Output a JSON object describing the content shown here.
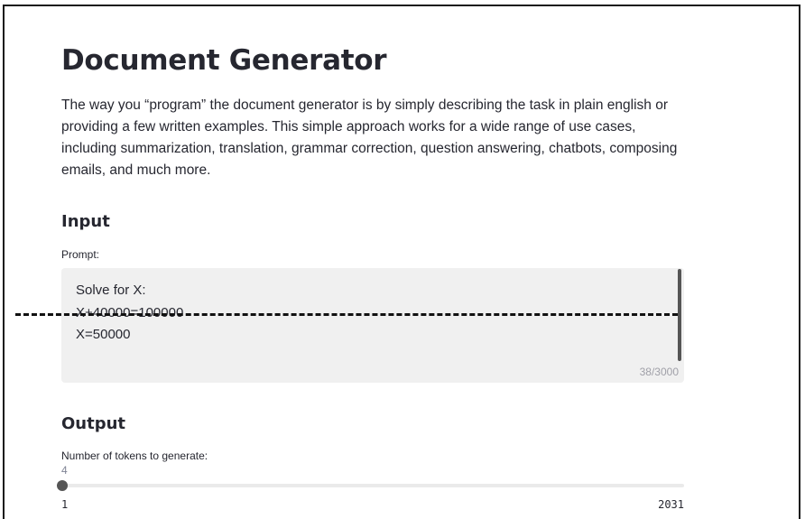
{
  "page": {
    "title": "Document Generator",
    "description": "The way you “program” the document generator is by simply describing the task in plain english or providing a few written examples. This simple approach works for a wide range of use cases, including summarization, translation, grammar correction, question answering, chatbots, composing emails, and much more."
  },
  "input": {
    "heading": "Input",
    "prompt_label": "Prompt:",
    "prompt_value": "Solve for X:\nX+40000=100000\nX=50000",
    "char_count": "38/3000"
  },
  "output": {
    "heading": "Output",
    "tokens_label": "Number of tokens to generate:",
    "tokens_value": "4",
    "tokens_min": "1",
    "tokens_max": "2031"
  },
  "colors": {
    "text": "#262730",
    "slider": "#555555",
    "annotation_line": "#111111"
  },
  "icons": {
    "slider_thumb": "slider-thumb-icon"
  }
}
